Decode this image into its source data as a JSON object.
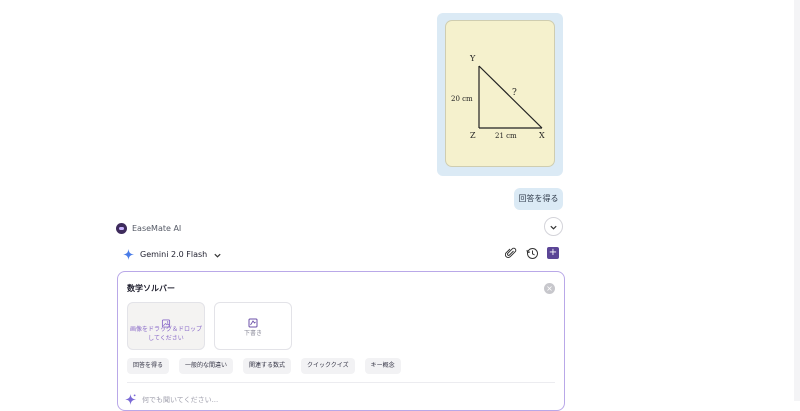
{
  "conversation": {
    "user_image": {
      "description_labels": {
        "vertex_y": "Y",
        "vertex_z": "Z",
        "vertex_x": "X",
        "side_yz": "20 cm",
        "side_zx": "21 cm",
        "hypotenuse": "?"
      }
    },
    "user_message": "回答を得る",
    "assistant_name": "EaseMate AI"
  },
  "model_selector": {
    "label": "Gemini 2.0 Flash",
    "icon": "sparkle-icon"
  },
  "toolbar": {
    "icons": [
      "paperclip-icon",
      "history-icon",
      "new-chat-icon"
    ]
  },
  "panel": {
    "title": "数学ソルバー",
    "upload_drag_label": "画像をドラッグ＆ドロップしてください",
    "handwrite_label": "下書き",
    "chips": [
      "回答を得る",
      "一般的な間違い",
      "関連する数式",
      "クイッククイズ",
      "キー概念"
    ],
    "input_placeholder": "何でも聞いてください..."
  },
  "colors": {
    "bubble": "#dbeaf5",
    "accent": "#5b4596",
    "panel_border": "#b9a8e8",
    "image_bg": "#f5f1cd"
  }
}
